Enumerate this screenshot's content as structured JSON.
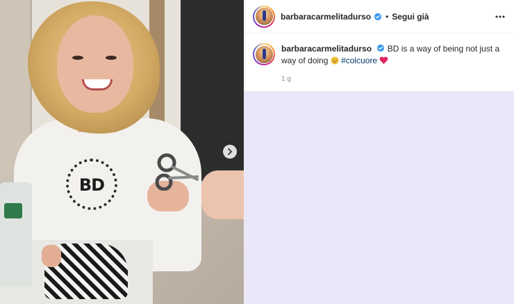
{
  "post": {
    "username": "barbaracarmelitadurso",
    "separator": "•",
    "follow_label": "Segui già",
    "caption_text": "BD is a way of being not just a way of doing",
    "hashtag": "#colcuore",
    "timestamp": "1 g",
    "logo_text": "BD"
  },
  "icons": {
    "verified": "verified-badge-icon",
    "more": "more-options-icon",
    "next": "chevron-right-icon",
    "emoji_smile": "smile-emoji-icon",
    "emoji_heart": "red-heart-emoji-icon"
  },
  "colors": {
    "verified_blue": "#3897f0",
    "hashtag": "#00376b",
    "heart": "#e0245e",
    "comments_bg": "#e9e7f8"
  }
}
